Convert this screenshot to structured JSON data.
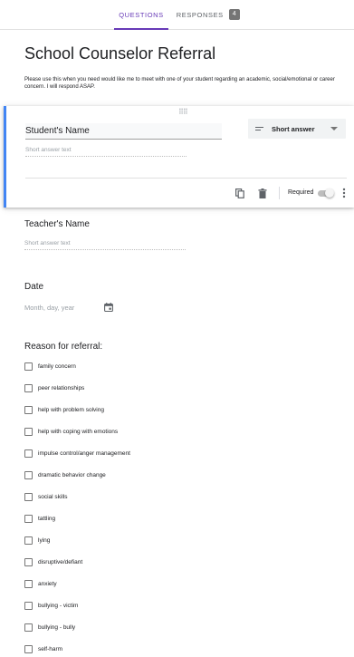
{
  "tabs": {
    "questions": "QUESTIONS",
    "responses": "RESPONSES",
    "responses_count": "4"
  },
  "form": {
    "title": "School Counselor Referral",
    "description": "Please use this when you need would like me to meet with one of your student regarding an academic, social/emotional or career concern.  I will respond ASAP."
  },
  "active_question": {
    "title": "Student's Name",
    "hint": "Short answer text",
    "type_label": "Short answer",
    "required_label": "Required",
    "required": false
  },
  "questions": {
    "teacher": {
      "title": "Teacher's Name",
      "hint": "Short answer text"
    },
    "date": {
      "title": "Date",
      "hint": "Month, day, year"
    },
    "reason": {
      "title": "Reason for referral:",
      "options": [
        "family concern",
        "peer relationships",
        "help with problem solving",
        "help with coping with emotions",
        "impulse control/anger management",
        "dramatic behavior change",
        "social skills",
        "tattling",
        "lying",
        "disruptive/defiant",
        "anxiety",
        "bullying - victim",
        "bullying - bully",
        "self-harm"
      ]
    }
  },
  "colors": {
    "accent": "#673ab7",
    "active_border": "#4285f4",
    "badge": "#757575"
  },
  "icons": [
    "drag-handle-icon",
    "short-answer-lines-icon",
    "chevron-down-icon",
    "copy-icon",
    "trash-icon",
    "more-vert-icon",
    "calendar-icon"
  ]
}
